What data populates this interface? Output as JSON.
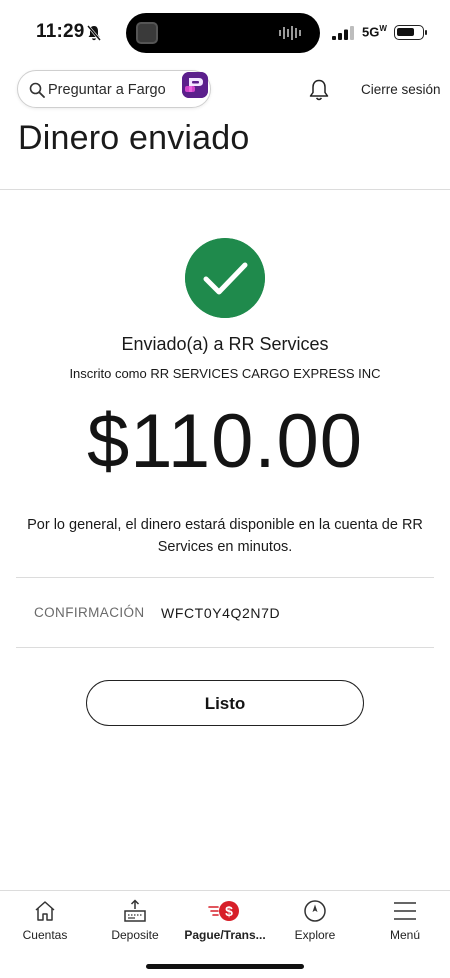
{
  "status_bar": {
    "time": "11:29",
    "network": "5G",
    "network_suffix": "W"
  },
  "header": {
    "search_placeholder": "Preguntar a Fargo",
    "logout_label": "Cierre sesión",
    "notifications_icon": "bell-icon"
  },
  "page": {
    "title": "Dinero enviado"
  },
  "confirmation": {
    "status_icon": "checkmark-circle-icon",
    "status_color": "#1f8a4c",
    "sent_to": "Enviado(a) a RR Services",
    "registered_as": "Inscrito como RR SERVICES CARGO EXPRESS INC",
    "amount": "$110.00",
    "availability_note": "Por lo general, el dinero estará disponible en la cuenta de RR Services en minutos.",
    "confirmation_label": "CONFIRMACIÓN",
    "confirmation_number": "WFCT0Y4Q2N7D",
    "done_button": "Listo"
  },
  "bottom_nav": {
    "items": [
      {
        "label": "Cuentas",
        "icon": "home-icon",
        "active": false
      },
      {
        "label": "Deposite",
        "icon": "deposit-icon",
        "active": false
      },
      {
        "label": "Pague/Trans...",
        "icon": "pay-transfer-icon",
        "active": true
      },
      {
        "label": "Explore",
        "icon": "compass-icon",
        "active": false
      },
      {
        "label": "Menú",
        "icon": "menu-icon",
        "active": false
      }
    ],
    "accent_color": "#d71e28"
  }
}
